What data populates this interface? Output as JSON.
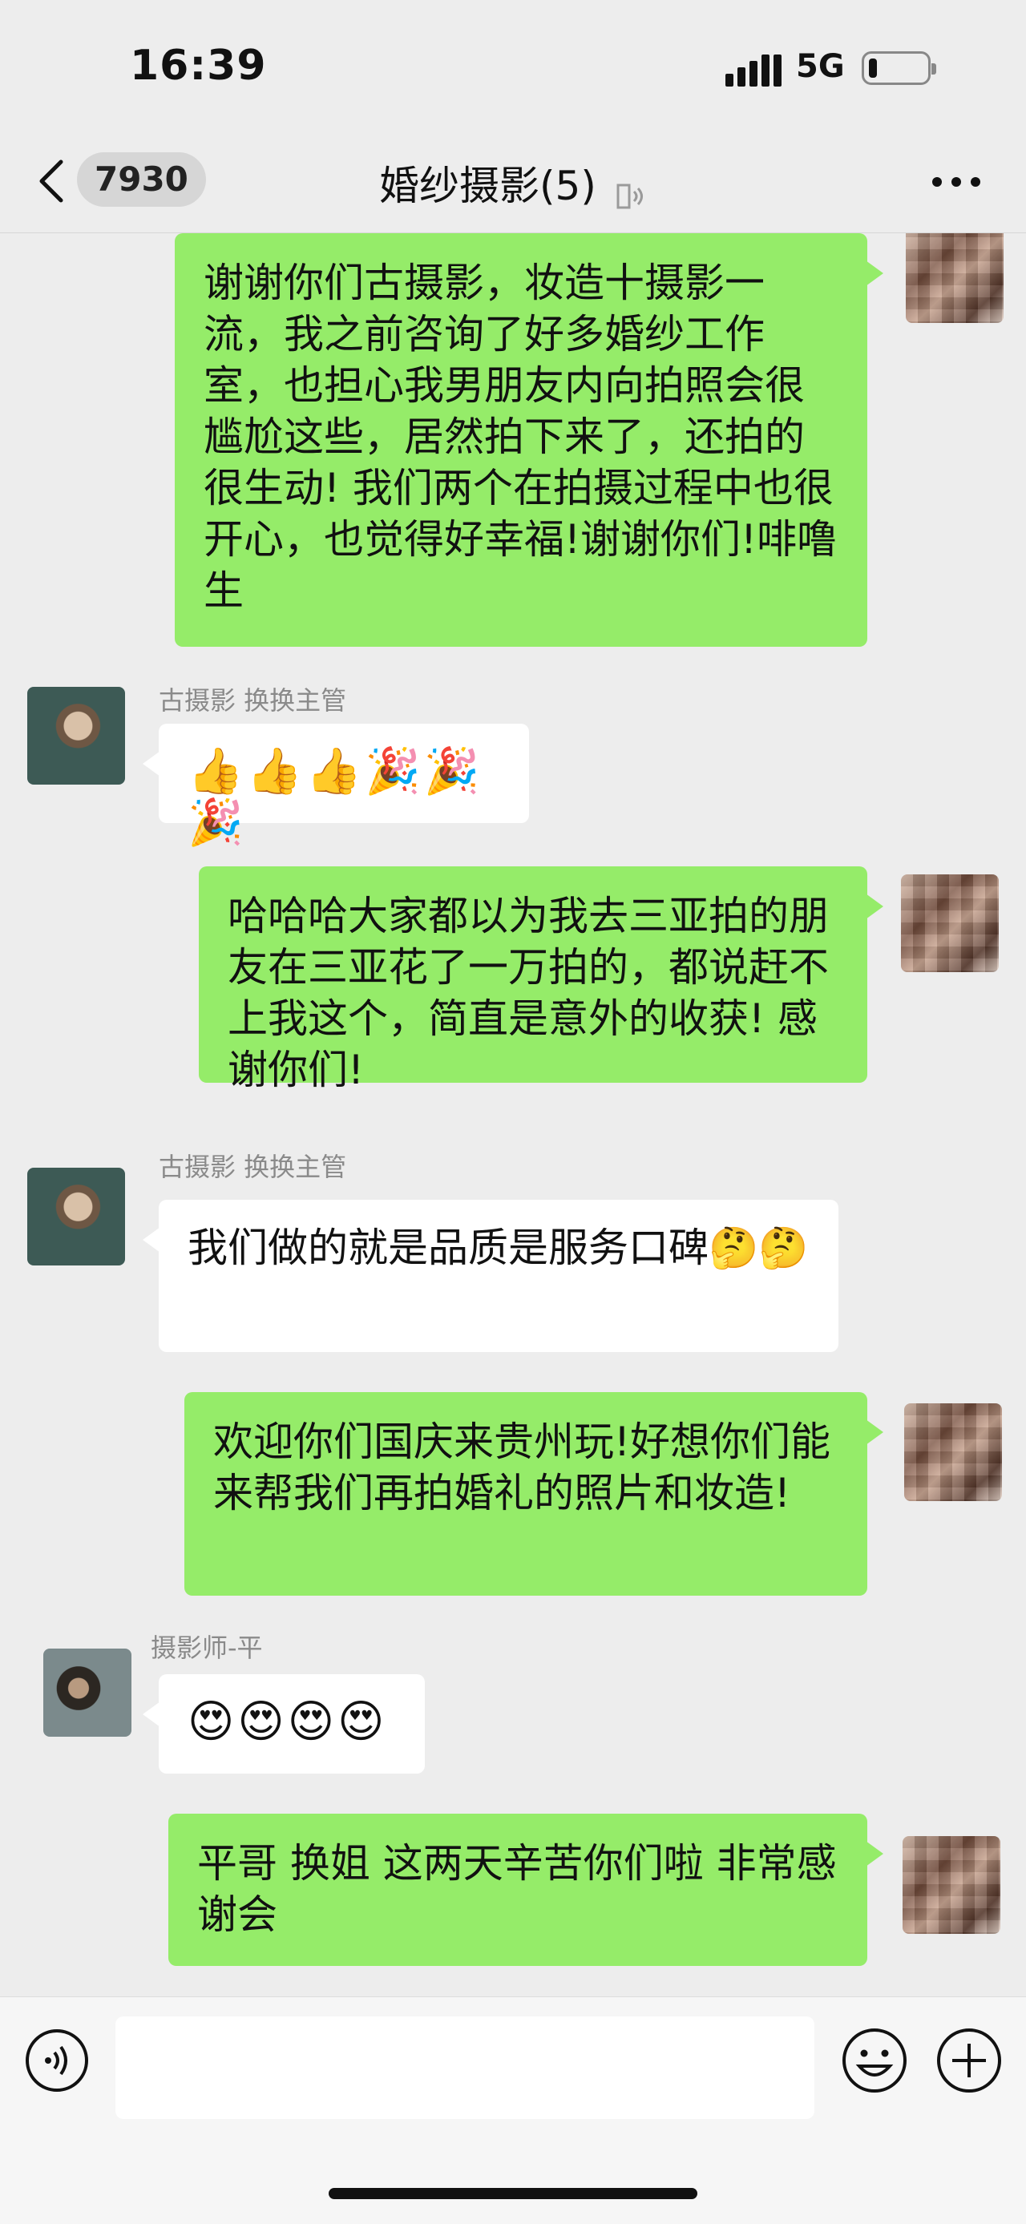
{
  "status_bar": {
    "time": "16:39",
    "network": "5G",
    "battery_level": 0.15
  },
  "header": {
    "unread_count": "7930",
    "title": "婚纱摄影(5)"
  },
  "messages": [
    {
      "side": "right",
      "text": "谢谢你们古摄影，妆造十摄影一流，我之前咨询了好多婚纱工作室，也担心我男朋友内向拍照会很尴尬这些，居然拍下来了，还拍的很生动! 我们两个在拍摄过程中也很开心，也觉得好幸福!谢谢你们!啡噜生"
    },
    {
      "side": "left",
      "sender": "古摄影 换换主管",
      "text": "👍👍👍🎉🎉🎉"
    },
    {
      "side": "right",
      "text": "哈哈哈大家都以为我去三亚拍的朋友在三亚花了一万拍的，都说赶不上我这个，简直是意外的收获! 感谢你们!"
    },
    {
      "side": "left",
      "sender": "古摄影 换换主管",
      "text": "我们做的就是品质是服务口碑🤔🤔"
    },
    {
      "side": "right",
      "text": "欢迎你们国庆来贵州玩!好想你们能来帮我们再拍婚礼的照片和妆造!"
    },
    {
      "side": "left",
      "sender": "摄影师-平",
      "text": "😍😍😍😍"
    },
    {
      "side": "right",
      "text": "平哥 换姐 这两天辛苦你们啦 非常感谢会"
    }
  ],
  "icons": {
    "back": "chevron-left-icon",
    "mute": "mute-icon",
    "more": "more-icon",
    "voice": "voice-icon",
    "emoji": "emoji-icon",
    "plus": "plus-icon"
  },
  "colors": {
    "background": "#ededed",
    "self_bubble": "#95ec69",
    "other_bubble": "#ffffff"
  }
}
